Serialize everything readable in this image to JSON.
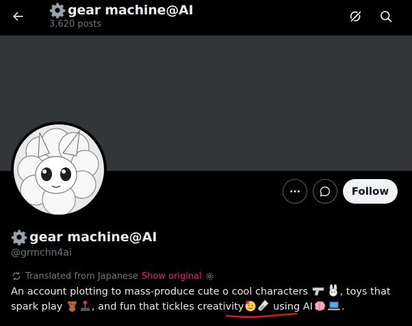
{
  "header": {
    "title": "gear machine@AI",
    "posts": "3,620 posts",
    "icons": [
      "arrow-left-icon",
      "grok-icon",
      "search-icon"
    ]
  },
  "banner": {
    "color": "#333639"
  },
  "actions": {
    "follow_label": "Follow",
    "icons": [
      "more-icon",
      "message-icon"
    ]
  },
  "profile": {
    "display_name": "gear machine@AI",
    "handle": "@grmchn4ai",
    "translated_label": "Translated from Japanese",
    "show_original": "Show original",
    "bio_part1": "An account plotting to mass-produce cute ",
    "bio_part2": " cool characters",
    "bio_part3": ", toys that spark play",
    "bio_part4": ", and fun that tickles creativity",
    "bio_part5": " using AI",
    "bio_part6": ".",
    "bio_connector": "ο"
  },
  "colors": {
    "accent_pink": "#f91880",
    "muted": "#71767b",
    "text": "#e7e9ea",
    "follow_bg": "#eff3f4",
    "annotation_red": "#d91a1a"
  }
}
